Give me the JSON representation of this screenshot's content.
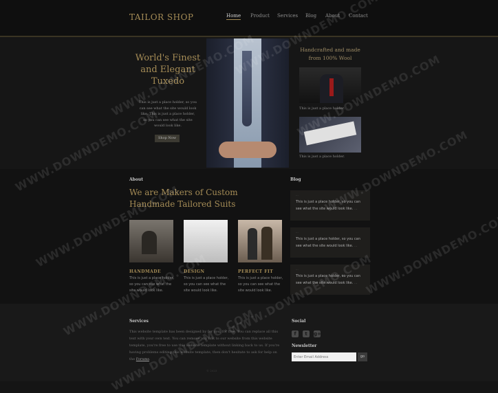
{
  "site": {
    "logo": "TAILOR SHOP"
  },
  "nav": [
    {
      "label": "Home",
      "active": true
    },
    {
      "label": "Product"
    },
    {
      "label": "Services"
    },
    {
      "label": "Blog"
    },
    {
      "label": "About"
    },
    {
      "label": "Contact"
    }
  ],
  "hero": {
    "title": "World's Finest and Elegant Tuxedo",
    "text": "This is just a place holder, so you can see what the site would look like. This is just a place holder, so you can see what the site would look like.",
    "button": "Shop Now"
  },
  "sidebar": {
    "title": "Handcrafted and made from 100% Wool",
    "captions": [
      "This is just a place holder.",
      "This is just a place holder."
    ]
  },
  "about": {
    "label": "About",
    "title": "We are Makers of Custom Handmade Tailored Suits",
    "features": [
      {
        "title": "HANDMADE",
        "text": "This is just a place holder, so you can see what the site would look like."
      },
      {
        "title": "DESIGN",
        "text": "This is just a place holder, so you can see what the site would look like."
      },
      {
        "title": "PERFECT FIT",
        "text": "This is just a place holder, so you can see what the site would look like."
      }
    ]
  },
  "blog": {
    "label": "Blog",
    "posts": [
      {
        "meta": "...",
        "text": "This is just a place holder, so you can see what the site would look like.",
        "more": "..."
      },
      {
        "meta": "...",
        "text": "This is just a place holder, so you can see what the site would look like.",
        "more": "..."
      },
      {
        "meta": "...",
        "text": "This is just a place holder, so you can see what the site would look like.",
        "more": "..."
      }
    ]
  },
  "footer": {
    "services_label": "Services",
    "services_text": "This website template has been designed by for you, for free. You can replace all this text with your own text. You can remove any link to our website from this website template, you're free to use this website template without linking back to us. If you're having problems editing this website template, then don't hesitate to ask for help on the",
    "services_link": "Forums",
    "social_label": "Social",
    "social_icons": [
      {
        "name": "facebook-icon",
        "glyph": "f"
      },
      {
        "name": "twitter-icon",
        "glyph": "t"
      },
      {
        "name": "googleplus-icon",
        "glyph": "g+"
      }
    ],
    "newsletter_label": "Newsletter",
    "email_placeholder": "Enter Email Address",
    "go_label": "go",
    "copyright": "© 2023"
  },
  "watermark": "WWW.DOWNDEMO.COM"
}
